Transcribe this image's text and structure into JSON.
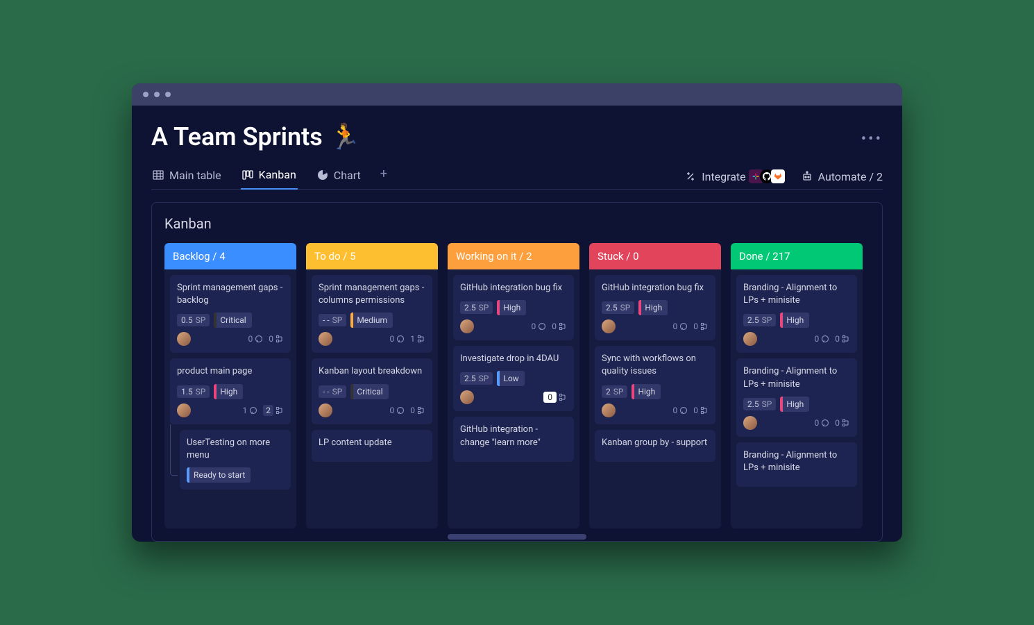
{
  "page": {
    "title": "A Team Sprints",
    "emoji": "🏃"
  },
  "tabs": [
    {
      "label": "Main table"
    },
    {
      "label": "Kanban"
    },
    {
      "label": "Chart"
    }
  ],
  "actions": {
    "integrate_label": "Integrate",
    "automate_label": "Automate / 2"
  },
  "board": {
    "title": "Kanban"
  },
  "columns": [
    {
      "name": "Backlog",
      "count": "4",
      "color": "#3b8eff",
      "cards": [
        {
          "title": "Sprint management gaps - backlog",
          "sp": "0.5",
          "sp_label": "SP",
          "priority": "Critical",
          "priority_color": "#333333",
          "comments": "0",
          "subtasks": "0"
        },
        {
          "title": "product main page",
          "sp": "1.5",
          "sp_label": "SP",
          "priority": "High",
          "priority_color": "#e8467e",
          "comments": "1",
          "subtasks": "2",
          "subtasks_highlight": true,
          "child": {
            "title": "UserTesting on more menu",
            "status": "Ready to start",
            "status_color": "#579bfc"
          }
        }
      ]
    },
    {
      "name": "To do",
      "count": "5",
      "color": "#fdbe2f",
      "cards": [
        {
          "title": "Sprint management gaps - columns permissions",
          "sp": "- -",
          "sp_label": "SP",
          "priority": "Medium",
          "priority_color": "#fdab3d",
          "comments": "0",
          "subtasks": "1"
        },
        {
          "title": "Kanban layout breakdown",
          "sp": "- -",
          "sp_label": "SP",
          "priority": "Critical",
          "priority_color": "#333333",
          "comments": "0",
          "subtasks": "0"
        },
        {
          "title": "LP content update"
        }
      ]
    },
    {
      "name": "Working on it",
      "count": "2",
      "color": "#fd9f3d",
      "cards": [
        {
          "title": "GitHub integration bug fix",
          "sp": "2.5",
          "sp_label": "SP",
          "priority": "High",
          "priority_color": "#e8467e",
          "comments": "0",
          "subtasks": "0"
        },
        {
          "title": "Investigate drop in 4DAU",
          "sp": "2.5",
          "sp_label": "SP",
          "priority": "Low",
          "priority_color": "#579bfc",
          "comments": "",
          "subtasks": "0",
          "subtasks_white": true
        },
        {
          "title": "GitHub integration - change \"learn more\""
        }
      ]
    },
    {
      "name": "Stuck",
      "count": "0",
      "color": "#e2445c",
      "cards": [
        {
          "title": "GitHub integration bug fix",
          "sp": "2.5",
          "sp_label": "SP",
          "priority": "High",
          "priority_color": "#e8467e",
          "comments": "0",
          "subtasks": "0"
        },
        {
          "title": "Sync with workflows on quality issues",
          "sp": "2",
          "sp_label": "SP",
          "priority": "High",
          "priority_color": "#e8467e",
          "comments": "0",
          "subtasks": "0"
        },
        {
          "title": "Kanban group by - support"
        }
      ]
    },
    {
      "name": "Done",
      "count": "217",
      "color": "#00c875",
      "cards": [
        {
          "title": "Branding  - Alignment to LPs + minisite",
          "sp": "2.5",
          "sp_label": "SP",
          "priority": "High",
          "priority_color": "#e8467e",
          "comments": "0",
          "subtasks": "0"
        },
        {
          "title": "Branding  - Alignment to LPs + minisite",
          "sp": "2.5",
          "sp_label": "SP",
          "priority": "High",
          "priority_color": "#e8467e",
          "comments": "0",
          "subtasks": "0"
        },
        {
          "title": "Branding  - Alignment to LPs + minisite"
        }
      ]
    }
  ]
}
